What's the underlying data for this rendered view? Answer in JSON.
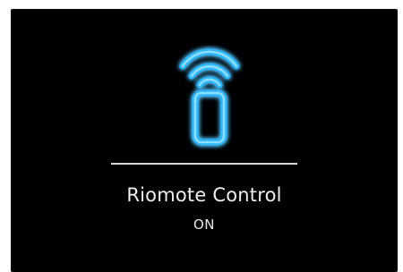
{
  "screen": {
    "icon": "remote-control-wifi-icon",
    "title": "Riomote Control",
    "status": "ON",
    "colors": {
      "background": "#000000",
      "icon_glow": "#2ab8ff",
      "icon_core": "#8fe0ff",
      "divider": "#d9d9d9",
      "text": "#f0f0f0"
    }
  }
}
